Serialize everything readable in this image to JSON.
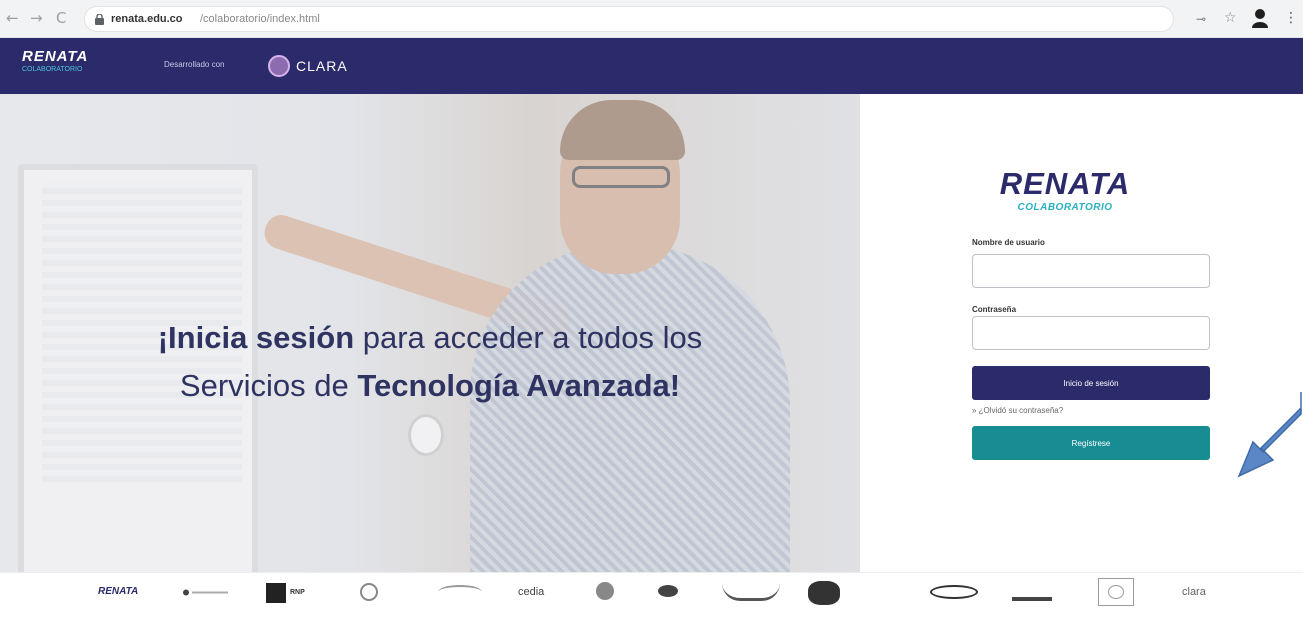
{
  "browser": {
    "nav": {
      "back": "←",
      "forward": "→",
      "reload": "C"
    },
    "url_host": "renata.edu.co",
    "url_path": "/colaboratorio/index.html"
  },
  "header": {
    "brand_name": "RENATA",
    "brand_subtitle": "COLABORATORIO",
    "developed_by": "Desarrollado con",
    "partner_name": "CLARA",
    "color": "#2b2a6a"
  },
  "hero": {
    "line1_bold": "¡Inicia sesión",
    "line1_rest": " para acceder a todos los",
    "line2_start": "Servicios de ",
    "line2_bold": "Tecnología Avanzada!"
  },
  "login": {
    "logo_name": "RENATA",
    "logo_subtitle": "COLABORATORIO",
    "username_label": "Nombre de usuario",
    "password_label": "Contraseña",
    "login_button": "Inicio de sesión",
    "forgot_link": "» ¿Olvidó su contraseña?",
    "register_button": "Regístrese",
    "login_color": "#2b2a6a",
    "register_color": "#178c93"
  },
  "footer": {
    "logos": [
      "RENATA",
      "RNP",
      "cedia",
      "clara"
    ]
  }
}
